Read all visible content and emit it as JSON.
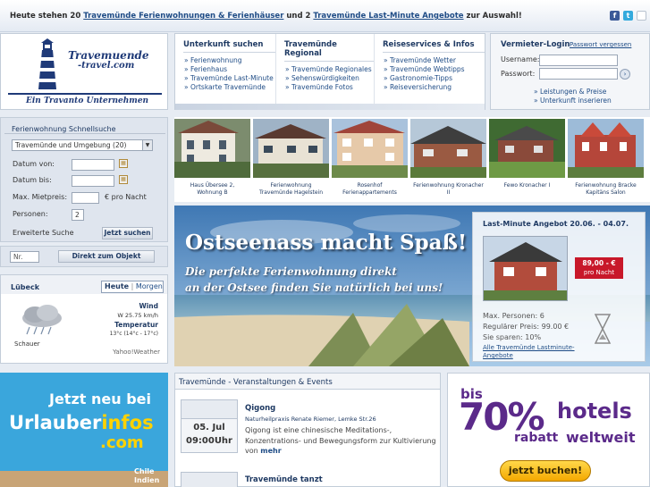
{
  "topbar": {
    "msg_a": "Heute stehen 20 ",
    "link_a": "Travemünde Ferienwohnungen & Ferienhäuser",
    "msg_b": " und 2 ",
    "link_b": "Travemünde Last-Minute Angebote",
    "msg_c": " zur Auswahl!"
  },
  "logo": {
    "line1": "Travemuende",
    "line2": "-travel.com",
    "tagline": "Ein Travanto Unternehmen"
  },
  "menu": {
    "cols": [
      {
        "title": "Unterkunft suchen",
        "items": [
          "Ferienwohnung",
          "Ferienhaus",
          "Travemünde Last-Minute",
          "Ortskarte Travemünde"
        ]
      },
      {
        "title": "Travemünde Regional",
        "items": [
          "Travemünde Regionales",
          "Sehenswürdigkeiten",
          "Travemünde Fotos"
        ]
      },
      {
        "title": "Reiseservices & Infos",
        "items": [
          "Travemünde Wetter",
          "Travemünde Webtipps",
          "Gastronomie-Tipps",
          "Reiseversicherung"
        ]
      }
    ]
  },
  "login": {
    "title": "Vermieter-Login",
    "forgot": "Passwort vergessen",
    "user_label": "Username:",
    "pass_label": "Passwort:",
    "link1": "Leistungen & Preise",
    "link2": "Unterkunft inserieren"
  },
  "search": {
    "title": "Ferienwohnung Schnellsuche",
    "region": "Travemünde und Umgebung (20)",
    "from_label": "Datum von:",
    "to_label": "Datum bis:",
    "price_label": "Max. Mietpreis:",
    "price_unit": "€ pro Nacht",
    "persons_label": "Personen:",
    "persons_value": "2",
    "advanced": "Erweiterte Suche",
    "submit": "Jetzt suchen",
    "nr_placeholder": "Nr.",
    "direct": "Direkt zum Objekt"
  },
  "weather": {
    "city": "Lübeck",
    "tab_today": "Heute",
    "tab_tomorrow": "Morgen",
    "wind_label": "Wind",
    "wind_value": "W 25.75 km/h",
    "temp_label": "Temperatur",
    "temp_value": "13°c (14°c - 17°c)",
    "condition": "Schauer",
    "credit": "Yahoo!Weather"
  },
  "photos": [
    {
      "cap1": "Haus Übersee 2,",
      "cap2": "Wohnung B"
    },
    {
      "cap1": "Ferienwohnung",
      "cap2": "Travemünde Hagelstein"
    },
    {
      "cap1": "Rosenhof",
      "cap2": "Ferienappartements"
    },
    {
      "cap1": "Ferienwohnung Kronacher",
      "cap2": "II"
    },
    {
      "cap1": "Fewo Kronacher I",
      "cap2": ""
    },
    {
      "cap1": "Ferienwohnung Bracke",
      "cap2": "Kapitäns Salon"
    }
  ],
  "banner": {
    "headline": "Ostseenass macht Spaß!",
    "sub1": "Die perfekte Ferienwohnung direkt",
    "sub2": "an der Ostsee finden Sie natürlich bei uns!"
  },
  "lastminute": {
    "title": "Last-Minute Angebot 20.06. - 04.07.",
    "price": "89,00 - €",
    "price_unit": "pro Nacht",
    "persons": "Max. Personen: 6",
    "regular": "Regulärer Preis: 99.00 €",
    "save": "Sie sparen: 10%",
    "all_link1": "Alle Travemünde Lastminute-",
    "all_link2": "Angebote"
  },
  "events": {
    "title": "Travemünde - Veranstaltungen & Events",
    "items": [
      {
        "date": "05. Jul",
        "time": "09:00Uhr",
        "name": "Qigong",
        "place": "Naturheilpraxis Renate Riemer, Lemke Str.26",
        "desc1": "Qigong ist eine chinesische Meditations-,",
        "desc2": "Konzentrations- und Bewegungsform zur Kultivierung",
        "desc3": "von",
        "more": "mehr"
      },
      {
        "name": "Travemünde tanzt"
      }
    ]
  },
  "ad_left": {
    "line1": "Jetzt neu bei",
    "brand1": "Urlauber",
    "brand2": "infos",
    "brand3": ".com",
    "extra1": "Chile",
    "extra2": "Indien"
  },
  "ad_right": {
    "bis": "bis",
    "pct": "70%",
    "rabatt": "rabatt",
    "hotels": "hotels",
    "weltweit": "weltweit",
    "cta": "jetzt buchen!"
  }
}
